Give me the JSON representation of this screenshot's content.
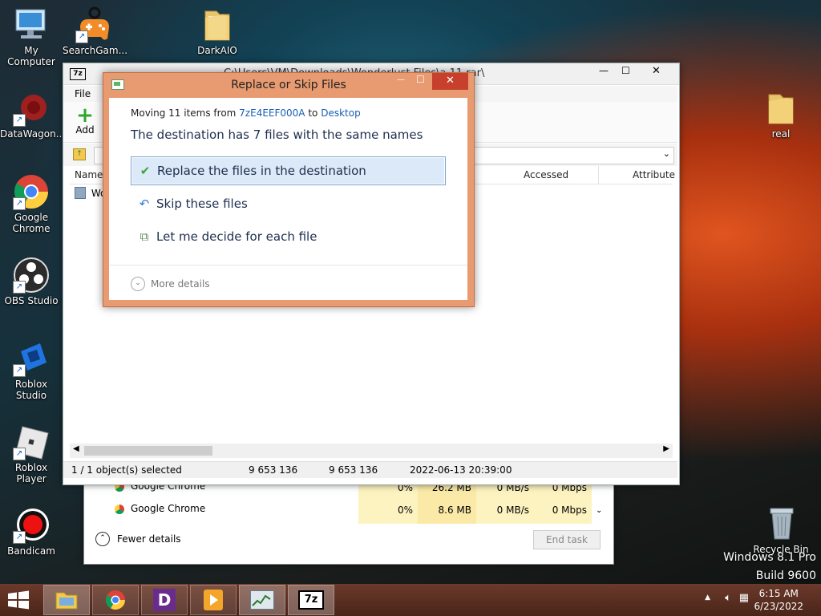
{
  "desktop": {
    "icons": [
      {
        "label": "My Computer"
      },
      {
        "label": "SearchGam..."
      },
      {
        "label": "DarkAIO"
      },
      {
        "label": "DataWagon..."
      },
      {
        "label": "Google Chrome"
      },
      {
        "label": "OBS Studio"
      },
      {
        "label": "Roblox Studio"
      },
      {
        "label": "Roblox Player"
      },
      {
        "label": "Bandicam"
      },
      {
        "label": "real"
      },
      {
        "label": "Recycle Bin"
      }
    ],
    "watermark": {
      "line1": "Windows 8.1 Pro",
      "line2": "Build 9600"
    }
  },
  "sevenzip": {
    "title": "C:\\Users\\VM\\Downloads\\Wonderlust Files\\a 11.rar\\",
    "menu": [
      "File"
    ],
    "toolbar": {
      "add_label": "Add"
    },
    "columns": [
      "Name",
      "Accessed",
      "Attribute"
    ],
    "row_name": "Wo",
    "status": {
      "selected": "1 / 1 object(s) selected",
      "size": "9 653 136",
      "packed": "9 653 136",
      "date": "2022-06-13 20:39:00"
    }
  },
  "taskmgr": {
    "rows": [
      {
        "name": "Google Chrome",
        "cpu": "0%",
        "mem": "26.2 MB",
        "disk": "0 MB/s",
        "net": "0 Mbps"
      },
      {
        "name": "Google Chrome",
        "cpu": "0%",
        "mem": "8.6 MB",
        "disk": "0 MB/s",
        "net": "0 Mbps"
      }
    ],
    "fewer_details": "Fewer details",
    "end_task": "End task"
  },
  "dialog": {
    "title": "Replace or Skip Files",
    "moving_prefix": "Moving 11 items from ",
    "source": "7zE4EEF000A",
    "to_word": " to ",
    "destination": "Desktop",
    "heading": "The destination has 7 files with the same names",
    "options": {
      "replace": "Replace the files in the destination",
      "skip": "Skip these files",
      "decide": "Let me decide for each file"
    },
    "more_details": "More details",
    "close_glyph": "✕",
    "min_glyph": "—",
    "max_glyph": "☐"
  },
  "taskbar": {
    "clock_time": "6:15 AM",
    "clock_date": "6/23/2022"
  },
  "colors": {
    "accent": "#e89a70",
    "close": "#c7402e",
    "link": "#1a5fb4"
  }
}
